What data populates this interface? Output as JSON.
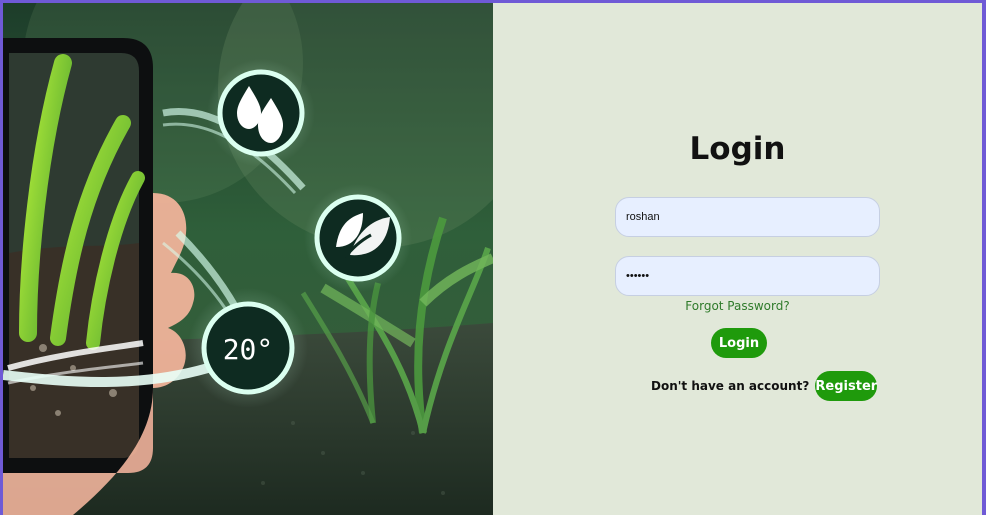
{
  "login": {
    "title": "Login",
    "username_value": "roshan",
    "password_value": "••••••",
    "forgot_label": "Forgot Password?",
    "login_label": "Login",
    "no_account_text": "Don't have an account?",
    "register_label": "Register"
  },
  "hero": {
    "temperature_label": "20°"
  },
  "colors": {
    "panel_bg": "#e1e8d9",
    "input_bg": "#e7efff",
    "brand_green": "#1f9a0c",
    "link_green": "#2f7b2b",
    "border_purple": "#6f5ad6"
  }
}
